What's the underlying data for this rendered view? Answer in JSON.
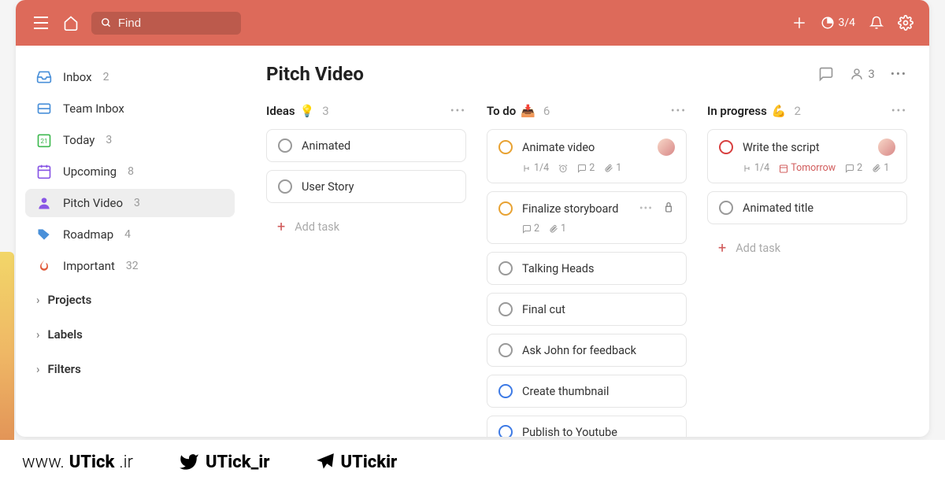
{
  "topbar": {
    "search_placeholder": "Find",
    "progress": "3/4"
  },
  "sidebar": {
    "items": [
      {
        "label": "Inbox",
        "count": "2",
        "icon": "inbox",
        "color": "#4a90d9"
      },
      {
        "label": "Team Inbox",
        "count": "",
        "icon": "team-inbox",
        "color": "#4a90d9"
      },
      {
        "label": "Today",
        "count": "3",
        "icon": "today",
        "color": "#3fb950"
      },
      {
        "label": "Upcoming",
        "count": "8",
        "icon": "upcoming",
        "color": "#8957e5"
      },
      {
        "label": "Pitch Video",
        "count": "3",
        "icon": "person",
        "color": "#8957e5",
        "active": true
      },
      {
        "label": "Roadmap",
        "count": "4",
        "icon": "tag",
        "color": "#4a90d9"
      },
      {
        "label": "Important",
        "count": "32",
        "icon": "flame",
        "color": "#e05a3a"
      }
    ],
    "sections": [
      {
        "label": "Projects"
      },
      {
        "label": "Labels"
      },
      {
        "label": "Filters"
      }
    ]
  },
  "board": {
    "title": "Pitch Video",
    "members": "3"
  },
  "columns": [
    {
      "name": "Ideas",
      "emoji": "💡",
      "count": "3",
      "cards": [
        {
          "title": "Animated",
          "checkbox_color": "gray"
        },
        {
          "title": "User Story",
          "checkbox_color": "gray"
        }
      ],
      "add_label": "Add task"
    },
    {
      "name": "To do",
      "emoji": "📥",
      "count": "6",
      "cards": [
        {
          "title": "Animate video",
          "checkbox_color": "orange",
          "avatar": true,
          "meta": {
            "subtasks": "1/4",
            "reminder": true,
            "comments": "2",
            "attachments": "1"
          }
        },
        {
          "title": "Finalize storyboard",
          "checkbox_color": "orange",
          "hover": true,
          "meta": {
            "comments": "2",
            "attachments": "1"
          }
        },
        {
          "title": "Talking Heads",
          "checkbox_color": "gray"
        },
        {
          "title": "Final cut",
          "checkbox_color": "gray"
        },
        {
          "title": "Ask John for feedback",
          "checkbox_color": "gray"
        },
        {
          "title": "Create thumbnail",
          "checkbox_color": "blue"
        },
        {
          "title": "Publish to Youtube",
          "checkbox_color": "blue"
        }
      ],
      "add_label": "Add task"
    },
    {
      "name": "In progress",
      "emoji": "💪",
      "count": "2",
      "cards": [
        {
          "title": "Write the script",
          "checkbox_color": "red",
          "avatar": true,
          "meta": {
            "subtasks": "1/4",
            "due": "Tomorrow",
            "comments": "2",
            "attachments": "1"
          }
        },
        {
          "title": "Animated title",
          "checkbox_color": "gray"
        }
      ],
      "add_label": "Add task"
    }
  ],
  "footer": {
    "site": {
      "pre": "www.",
      "main": "UTick",
      "suf": ".ir"
    },
    "twitter": "UTick_ir",
    "telegram": "UTickir"
  }
}
